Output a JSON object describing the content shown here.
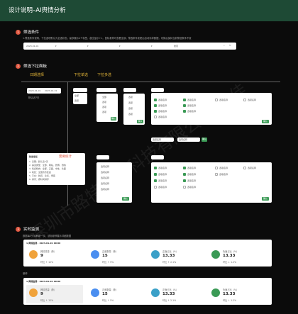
{
  "header": {
    "title": "设计说明–AI舆情分析"
  },
  "sections": [
    {
      "num": "1",
      "title": "筛选条件",
      "desc": "1.筛选条件说明，下拉选项默认为全选状态，最多展示4个标签，超出显示+n，鼠标悬停可查看全部；筛选条件变更后自动请求数据，切换后保持当前筛选条件不变"
    },
    {
      "num": "2",
      "title": "筛选下拉面板"
    },
    {
      "num": "3",
      "title": "实时监测",
      "desc": "数据每5分钟刷新一次，鼠标悬停展示详细数据"
    }
  ],
  "filter_bar": {
    "date": "2023-01-01",
    "search_label": "搜索"
  },
  "dropdown_labels": {
    "col1": "日期选择",
    "col2": "下拉单选",
    "col3": "下拉多选"
  },
  "date_picker": {
    "start": "2023-01-01",
    "end": "2023-01-31",
    "note": "默认近7天"
  },
  "single_options": [
    "全部",
    "选项"
  ],
  "multi_options": [
    "全部",
    "选项",
    "选项",
    "选项",
    "选项"
  ],
  "grid_option": "选项名称",
  "buttons": {
    "confirm": "确认",
    "reset": "重置"
  },
  "notes": {
    "title": "需要统计",
    "heading": "数据看板",
    "items": [
      "1. 日期：默认近7天",
      "2. 渠道类型：全部、网站、微博、微信",
      "3. 情感倾向：全部、正面、中性、负面",
      "4. 地区：全国省市区县",
      "5. 平台：新闻、论坛、博客",
      "6. 排序：按时间排序"
    ]
  },
  "selected_tags": [
    "选项名称",
    "选项名称"
  ],
  "kpi_panels": [
    {
      "title": "1.舆情监测 · 2023-01-01 00:00",
      "items": [
        {
          "label": "舆情总量（条）",
          "value": "9",
          "sub": "环比 ↑ 12%",
          "color": "#f0a23a"
        },
        {
          "label": "正面数量（条）",
          "value": "15",
          "sub": "环比 ↑ 5%",
          "color": "#4a8ef0"
        },
        {
          "label": "正面占比（%）",
          "value": "13.33",
          "sub": "环比 ↑ 2.1%",
          "color": "#3aa0c8"
        },
        {
          "label": "负面占比（%）",
          "value": "13.33",
          "sub": "环比 ↓ 1.2%",
          "color": "#3a9a55"
        }
      ]
    },
    {
      "title": "1.舆情监测 · 2023-01-01 00:00",
      "items": [
        {
          "label": "舆情总量（条）",
          "value": "9",
          "sub": "环比 ↑ 12%",
          "color": "#f0a23a"
        },
        {
          "label": "正面数量（条）",
          "value": "15",
          "sub": "环比 ↑ 5%",
          "color": "#4a8ef0"
        },
        {
          "label": "正面占比（%）",
          "value": "13.33",
          "sub": "环比 ↑ 2.1%",
          "color": "#3aa0c8"
        },
        {
          "label": "负面占比（%）",
          "value": "13.33",
          "sub": "环比 ↓ 1.2%",
          "color": "#3a9a55"
        }
      ]
    }
  ],
  "hover_label": "悬停",
  "watermark": "深圳市路特创新科技有限公司 未佳",
  "colors": {
    "header": "#1e4a35",
    "accent": "#e0563f",
    "green": "#3a9a55",
    "label_yellow": "#e8b93a"
  }
}
